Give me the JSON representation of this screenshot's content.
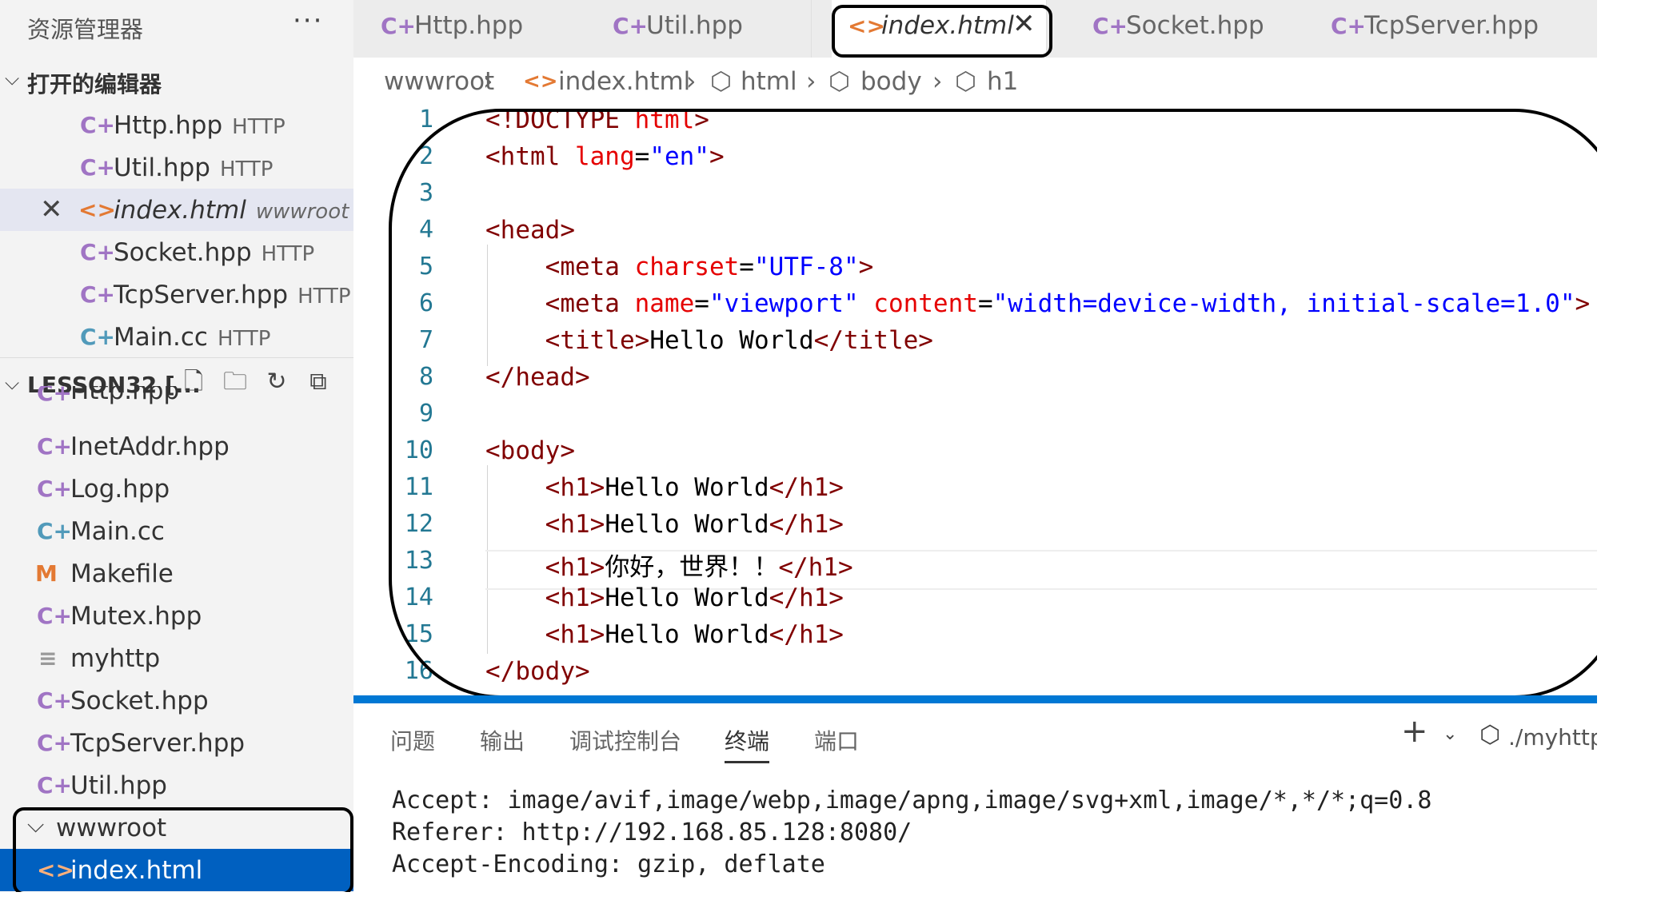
{
  "explorer": {
    "title": "资源管理器",
    "more": "···",
    "open_editors_label": "打开的编辑器",
    "open_editors": [
      {
        "name": "Http.hpp",
        "tag": "HTTP",
        "icon": "C+"
      },
      {
        "name": "Util.hpp",
        "tag": "HTTP",
        "icon": "C+"
      },
      {
        "name": "index.html",
        "tag": "wwwroot",
        "icon": "<>",
        "close": "✕"
      },
      {
        "name": "Socket.hpp",
        "tag": "HTTP",
        "icon": "C+"
      },
      {
        "name": "TcpServer.hpp",
        "tag": "HTTP",
        "icon": "C+"
      },
      {
        "name": "Main.cc",
        "tag": "HTTP",
        "icon": "C+"
      }
    ],
    "folder_label": "LESSON32 [...",
    "files": [
      {
        "name": "Http.hpp",
        "icon": "C+"
      },
      {
        "name": "InetAddr.hpp",
        "icon": "C+"
      },
      {
        "name": "Log.hpp",
        "icon": "C+"
      },
      {
        "name": "Main.cc",
        "icon": "C+"
      },
      {
        "name": "Makefile",
        "icon": "M"
      },
      {
        "name": "Mutex.hpp",
        "icon": "C+"
      },
      {
        "name": "myhttp",
        "icon": "≡"
      },
      {
        "name": "Socket.hpp",
        "icon": "C+"
      },
      {
        "name": "TcpServer.hpp",
        "icon": "C+"
      },
      {
        "name": "Util.hpp",
        "icon": "C+"
      }
    ],
    "wwwroot": "wwwroot",
    "wwwroot_file": "index.html"
  },
  "tabs": [
    {
      "name": "Http.hpp",
      "icon": "C+"
    },
    {
      "name": "Util.hpp",
      "icon": "C+"
    },
    {
      "name": "index.html",
      "icon": "<>",
      "close": "✕"
    },
    {
      "name": "Socket.hpp",
      "icon": "C+"
    },
    {
      "name": "TcpServer.hpp",
      "icon": "C+"
    }
  ],
  "breadcrumb": {
    "items": [
      "wwwroot",
      "index.html",
      "html",
      "body",
      "h1"
    ],
    "sep": "›"
  },
  "editor": {
    "line_numbers": [
      "1",
      "2",
      "3",
      "4",
      "5",
      "6",
      "7",
      "8",
      "9",
      "10",
      "11",
      "12",
      "13",
      "14",
      "15",
      "16"
    ],
    "lines": [
      [
        {
          "t": "tag",
          "v": "<!DOCTYPE "
        },
        {
          "t": "attr",
          "v": "html"
        },
        {
          "t": "tag",
          "v": ">"
        }
      ],
      [
        {
          "t": "tag",
          "v": "<html "
        },
        {
          "t": "attr",
          "v": "lang"
        },
        {
          "t": "txt",
          "v": "="
        },
        {
          "t": "val",
          "v": "\"en\""
        },
        {
          "t": "tag",
          "v": ">"
        }
      ],
      [],
      [
        {
          "t": "tag",
          "v": "<head>"
        }
      ],
      [
        {
          "t": "txt",
          "v": "    "
        },
        {
          "t": "tag",
          "v": "<meta "
        },
        {
          "t": "attr",
          "v": "charset"
        },
        {
          "t": "txt",
          "v": "="
        },
        {
          "t": "val",
          "v": "\"UTF-8\""
        },
        {
          "t": "tag",
          "v": ">"
        }
      ],
      [
        {
          "t": "txt",
          "v": "    "
        },
        {
          "t": "tag",
          "v": "<meta "
        },
        {
          "t": "attr",
          "v": "name"
        },
        {
          "t": "txt",
          "v": "="
        },
        {
          "t": "val",
          "v": "\"viewport\""
        },
        {
          "t": "txt",
          "v": " "
        },
        {
          "t": "attr",
          "v": "content"
        },
        {
          "t": "txt",
          "v": "="
        },
        {
          "t": "val",
          "v": "\"width=device-width, initial-scale=1.0\""
        },
        {
          "t": "tag",
          "v": ">"
        }
      ],
      [
        {
          "t": "txt",
          "v": "    "
        },
        {
          "t": "tag",
          "v": "<title>"
        },
        {
          "t": "txt",
          "v": "Hello World"
        },
        {
          "t": "tag",
          "v": "</title>"
        }
      ],
      [
        {
          "t": "tag",
          "v": "</head>"
        }
      ],
      [],
      [
        {
          "t": "tag",
          "v": "<body>"
        }
      ],
      [
        {
          "t": "txt",
          "v": "    "
        },
        {
          "t": "tag",
          "v": "<h1>"
        },
        {
          "t": "txt",
          "v": "Hello World"
        },
        {
          "t": "tag",
          "v": "</h1>"
        }
      ],
      [
        {
          "t": "txt",
          "v": "    "
        },
        {
          "t": "tag",
          "v": "<h1>"
        },
        {
          "t": "txt",
          "v": "Hello World"
        },
        {
          "t": "tag",
          "v": "</h1>"
        }
      ],
      [
        {
          "t": "txt",
          "v": "    "
        },
        {
          "t": "tag",
          "v": "<h1>"
        },
        {
          "t": "txt",
          "v": "你好，世界！！"
        },
        {
          "t": "tag",
          "v": "</h1>"
        }
      ],
      [
        {
          "t": "txt",
          "v": "    "
        },
        {
          "t": "tag",
          "v": "<h1>"
        },
        {
          "t": "txt",
          "v": "Hello World"
        },
        {
          "t": "tag",
          "v": "</h1>"
        }
      ],
      [
        {
          "t": "txt",
          "v": "    "
        },
        {
          "t": "tag",
          "v": "<h1>"
        },
        {
          "t": "txt",
          "v": "Hello World"
        },
        {
          "t": "tag",
          "v": "</h1>"
        }
      ],
      [
        {
          "t": "tag",
          "v": "</body>"
        }
      ]
    ]
  },
  "panel": {
    "tabs": [
      "问题",
      "输出",
      "调试控制台",
      "终端",
      "端口"
    ],
    "active_tab": "终端",
    "plus": "+",
    "chevron": "⌄",
    "terminal_icon": "⬡",
    "terminal_name": "./myhttp",
    "terminal_lines": [
      "Accept: image/avif,image/webp,image/apng,image/svg+xml,image/*,*/*;q=0.8",
      "Referer: http://192.168.85.128:8080/",
      "Accept-Encoding: gzip, deflate"
    ]
  },
  "colors": {
    "accent": "#0078d4",
    "selected_row": "#0060c0",
    "tag": "#800000",
    "attr": "#e50000",
    "value": "#0000ff"
  }
}
